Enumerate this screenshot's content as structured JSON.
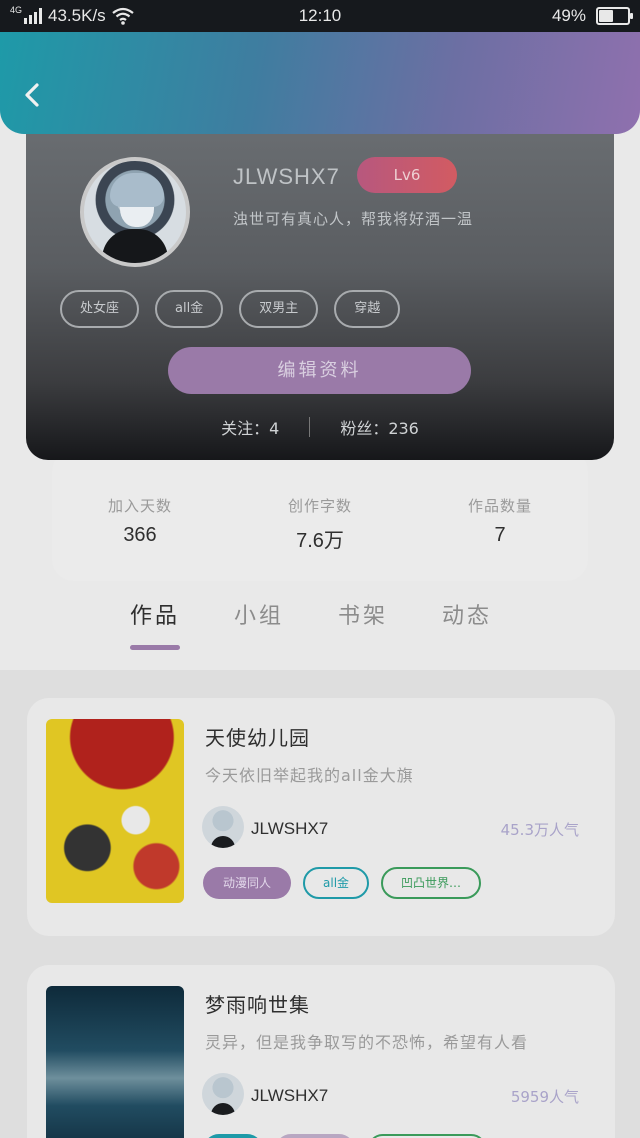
{
  "status_bar": {
    "network_type": "4G",
    "speed": "43.5K/s",
    "time": "12:10",
    "battery": "49%",
    "battery_level": 0.49
  },
  "header": {
    "back_icon": "chevron-left-icon"
  },
  "profile": {
    "username": "JLWSHX7",
    "level": "Lv6",
    "signature": "浊世可有真心人，帮我将好酒一温",
    "tags": [
      "处女座",
      "all金",
      "双男主",
      "穿越"
    ],
    "edit_button": "编辑资料",
    "following_label": "关注：4",
    "followers_label": "粉丝：236"
  },
  "stats": [
    {
      "label": "加入天数",
      "value": "366"
    },
    {
      "label": "创作字数",
      "value": "7.6万"
    },
    {
      "label": "作品数量",
      "value": "7"
    }
  ],
  "tabs": [
    {
      "label": "作品",
      "active": true
    },
    {
      "label": "小组",
      "active": false
    },
    {
      "label": "书架",
      "active": false
    },
    {
      "label": "动态",
      "active": false
    }
  ],
  "works": [
    {
      "title": "天使幼儿园",
      "description": "今天依旧举起我的all金大旗",
      "author": "JLWSHX7",
      "popularity": "45.3万人气",
      "tags": [
        {
          "label": "动漫同人",
          "style": "purple"
        },
        {
          "label": "all金",
          "style": "teal"
        },
        {
          "label": "凹凸世界…",
          "style": "green"
        }
      ]
    },
    {
      "title": "梦雨响世集",
      "description": "灵异，但是我争取写的不恐怖，希望有人看",
      "author": "JLWSHX7",
      "popularity": "5959人气"
    }
  ],
  "colors": {
    "accent_purple": "#9a7aa8",
    "level_badge": "#c8566f",
    "header_gradient_start": "#1e9aa8",
    "header_gradient_end": "#8f70ae"
  }
}
